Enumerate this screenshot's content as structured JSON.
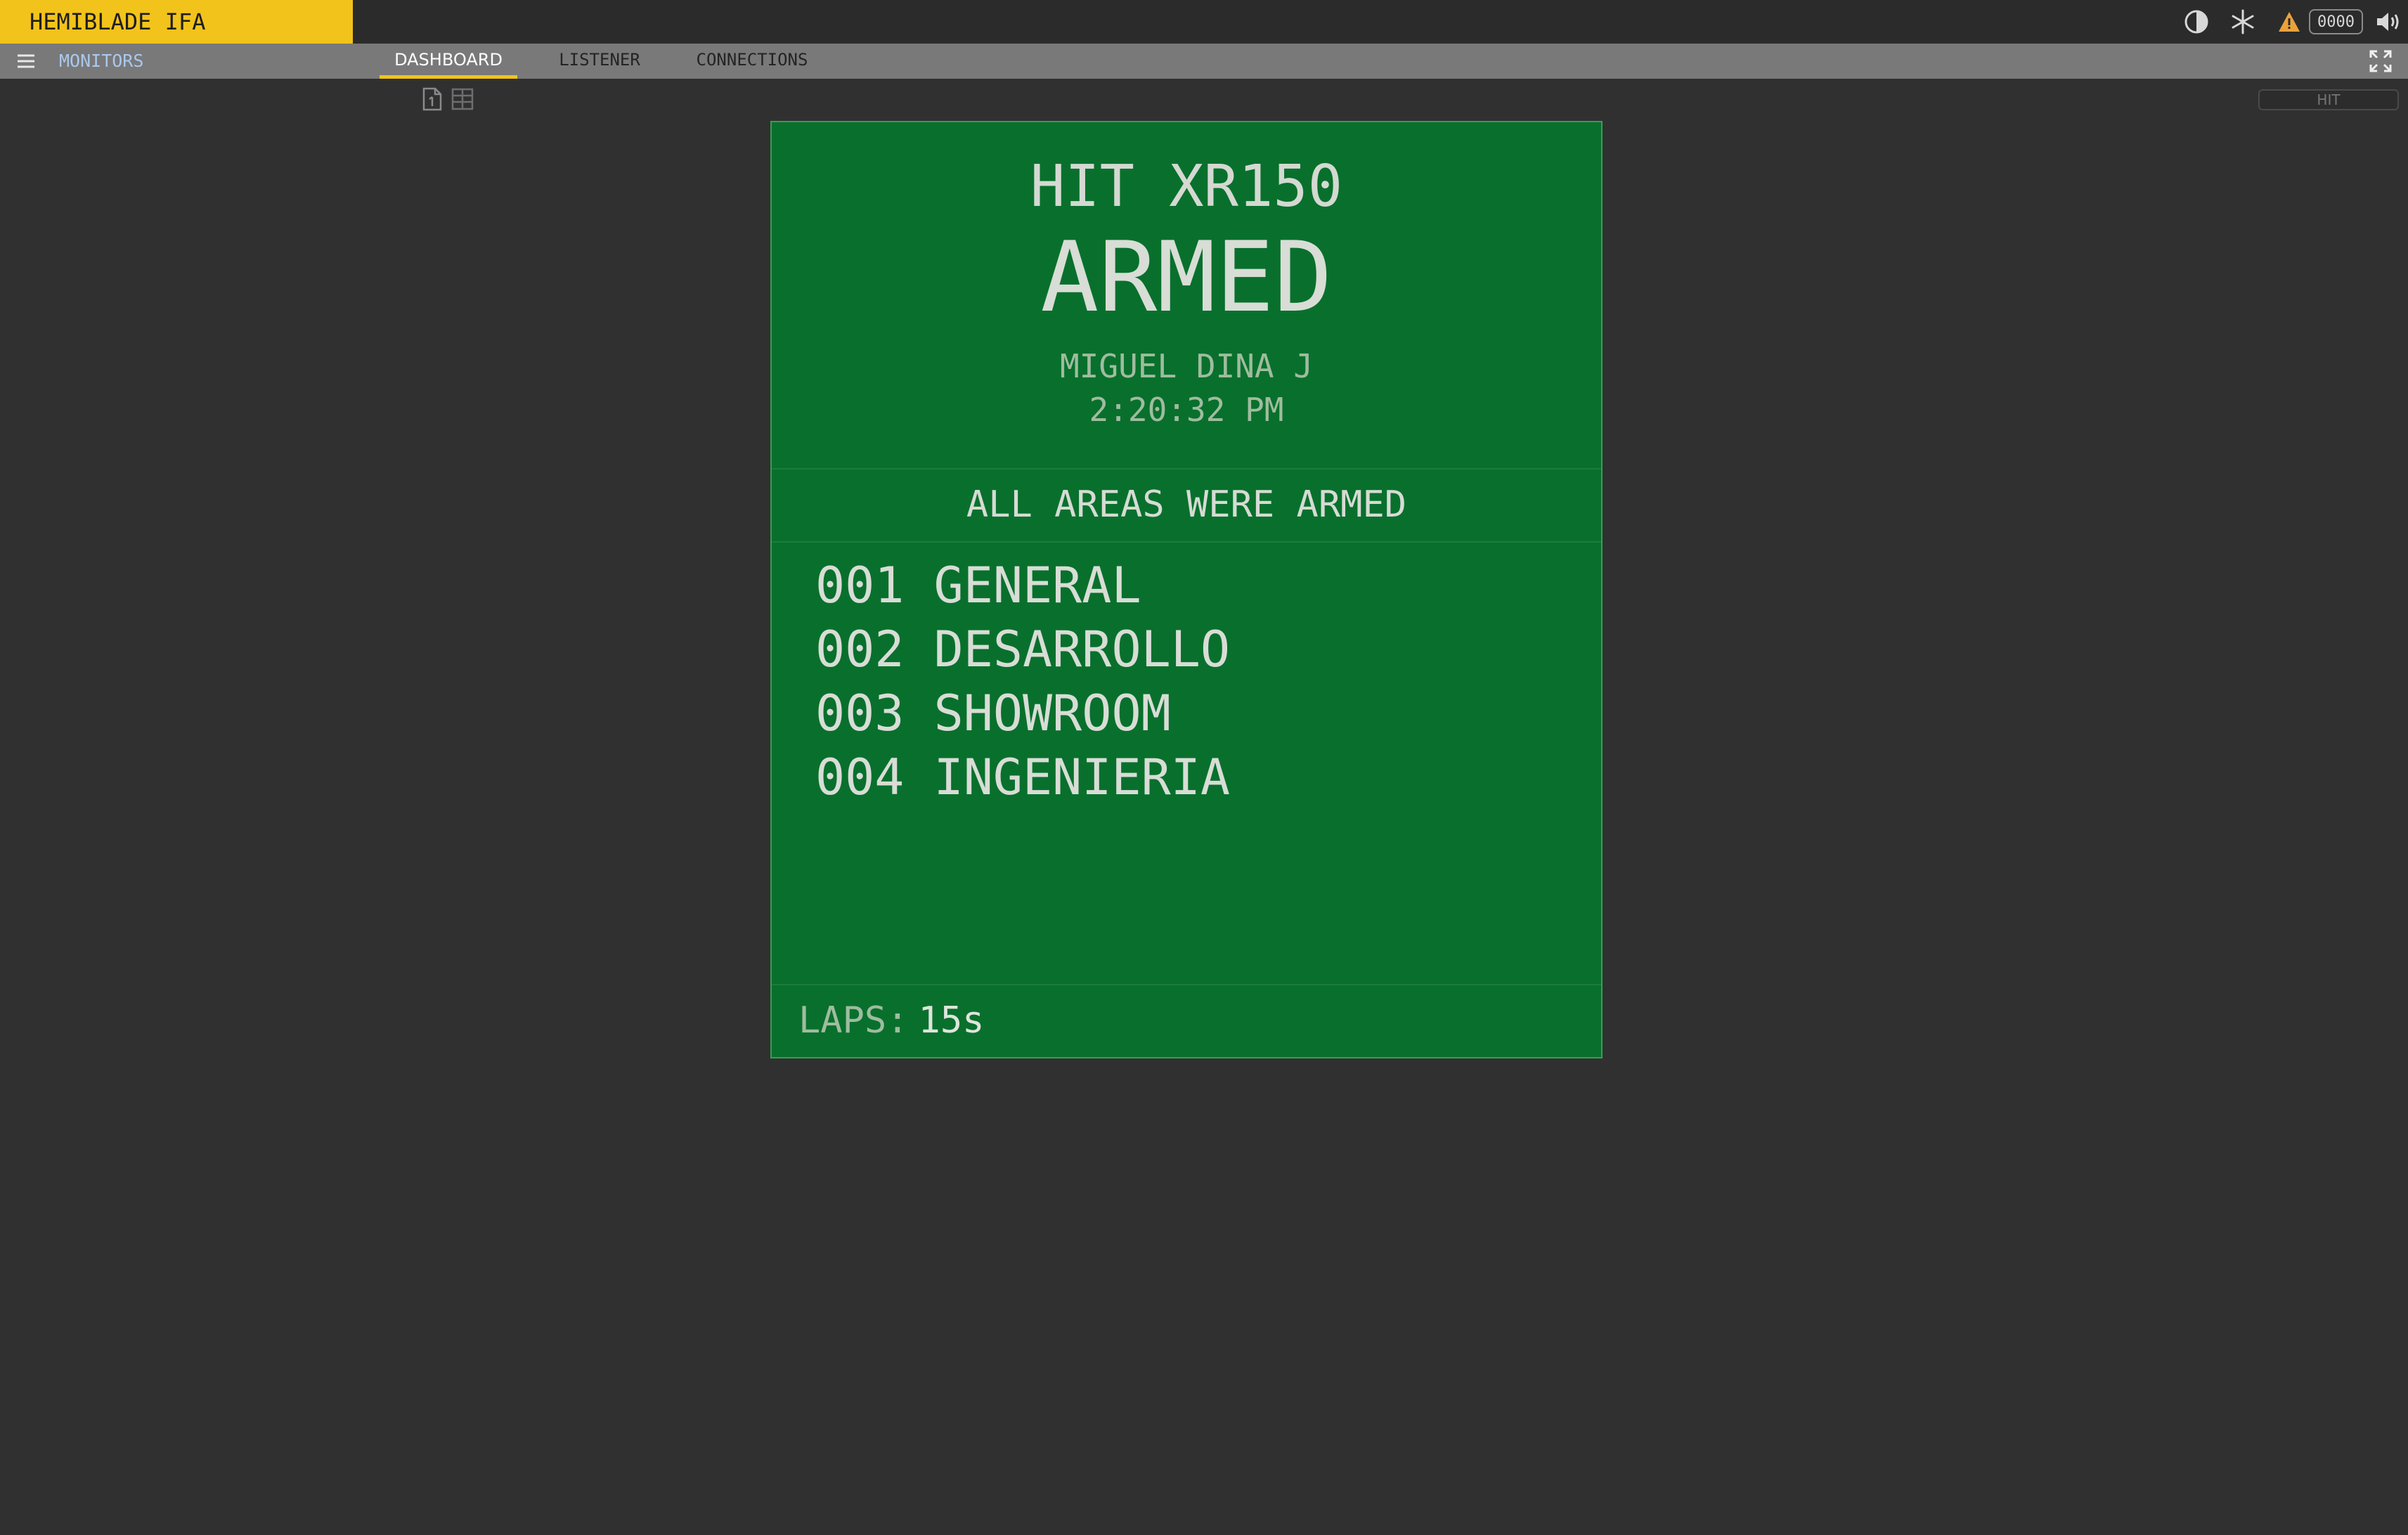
{
  "app": {
    "title": "HEMIBLADE IFA"
  },
  "topbar": {
    "icons": [
      "contrast-icon",
      "snowflake-icon",
      "warning-icon",
      "speaker-icon"
    ],
    "counter": "0000"
  },
  "nav": {
    "section": "MONITORS",
    "tabs": [
      {
        "label": "DASHBOARD",
        "active": true
      },
      {
        "label": "LISTENER",
        "active": false
      },
      {
        "label": "CONNECTIONS",
        "active": false
      }
    ]
  },
  "toolbar": {
    "filter_placeholder": "HIT"
  },
  "monitor": {
    "device": "HIT XR150",
    "status": "ARMED",
    "user": "MIGUEL DINA J",
    "time": "2:20:32 PM",
    "message": "ALL AREAS WERE ARMED",
    "areas": [
      {
        "number": "001",
        "name": "GENERAL"
      },
      {
        "number": "002",
        "name": "DESARROLLO"
      },
      {
        "number": "003",
        "name": "SHOWROOM"
      },
      {
        "number": "004",
        "name": "INGENIERIA"
      }
    ],
    "laps_label": "LAPS:",
    "laps_value": "15s"
  },
  "colors": {
    "brand": "#f2c31b",
    "card_armed": "#08702c",
    "background": "#303030",
    "nav": "#797979"
  }
}
